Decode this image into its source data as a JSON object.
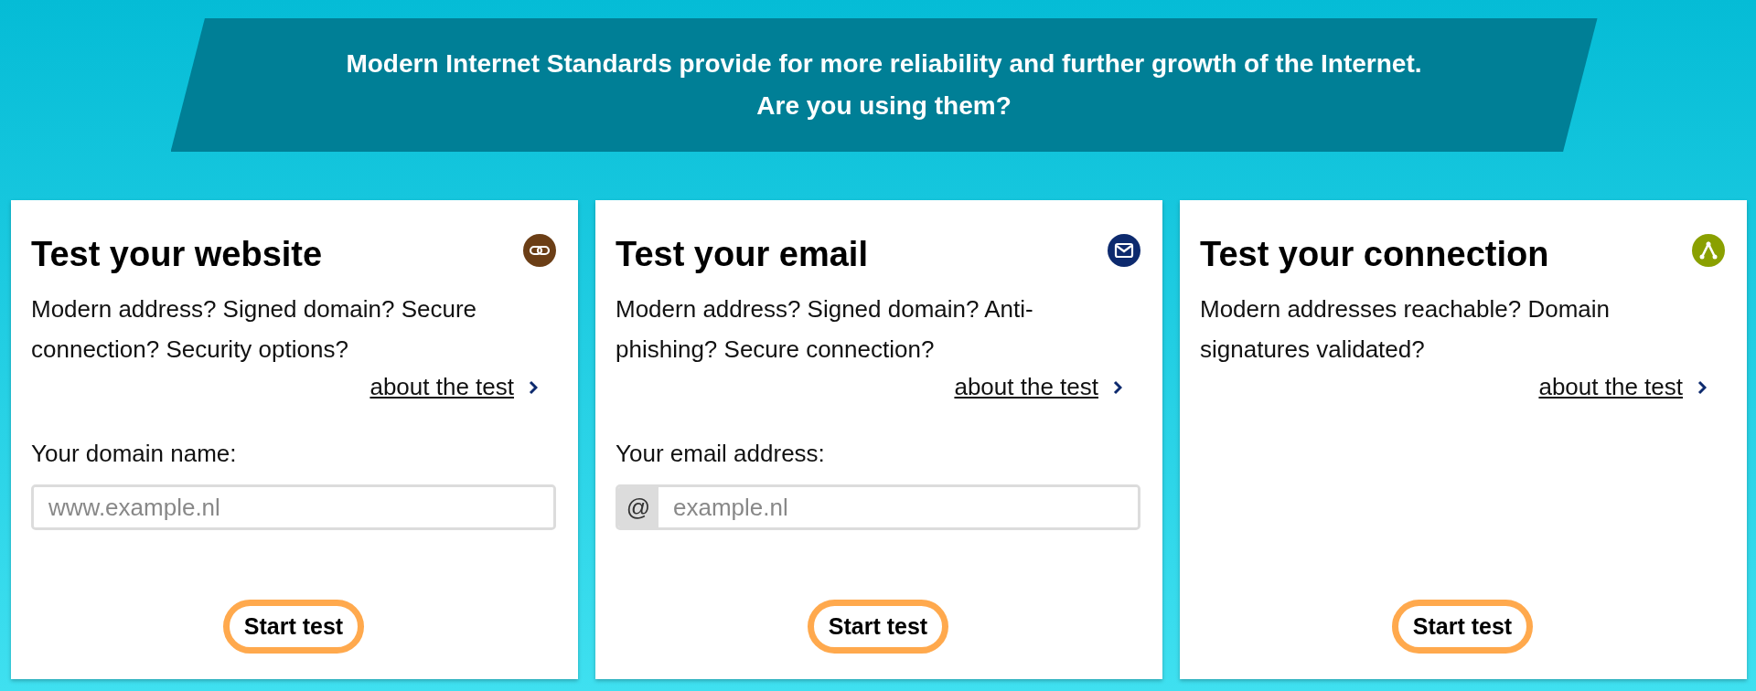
{
  "banner": {
    "lines": [
      "Modern Internet Standards provide for more reliability and further growth of the Internet.",
      "Are you using them?"
    ]
  },
  "cards": [
    {
      "kind": "website",
      "title": "Test your website",
      "description": "Modern address? Signed domain? Secure connection? Security options?",
      "link": "about the test",
      "field": {
        "label": "Your domain name:",
        "placeholder": "www.example.nl"
      },
      "button": "Start test"
    },
    {
      "kind": "email",
      "title": "Test your email",
      "description": "Modern address? Signed domain? Anti-phishing? Secure connection?",
      "link": "about the test",
      "field": {
        "label": "Your email address:",
        "prefix": "@",
        "placeholder": "example.nl"
      },
      "button": "Start test"
    },
    {
      "kind": "connection",
      "title": "Test your connection",
      "description": "Modern addresses reachable? Domain signatures validated?",
      "link": "about the test",
      "button": "Start test"
    }
  ]
}
